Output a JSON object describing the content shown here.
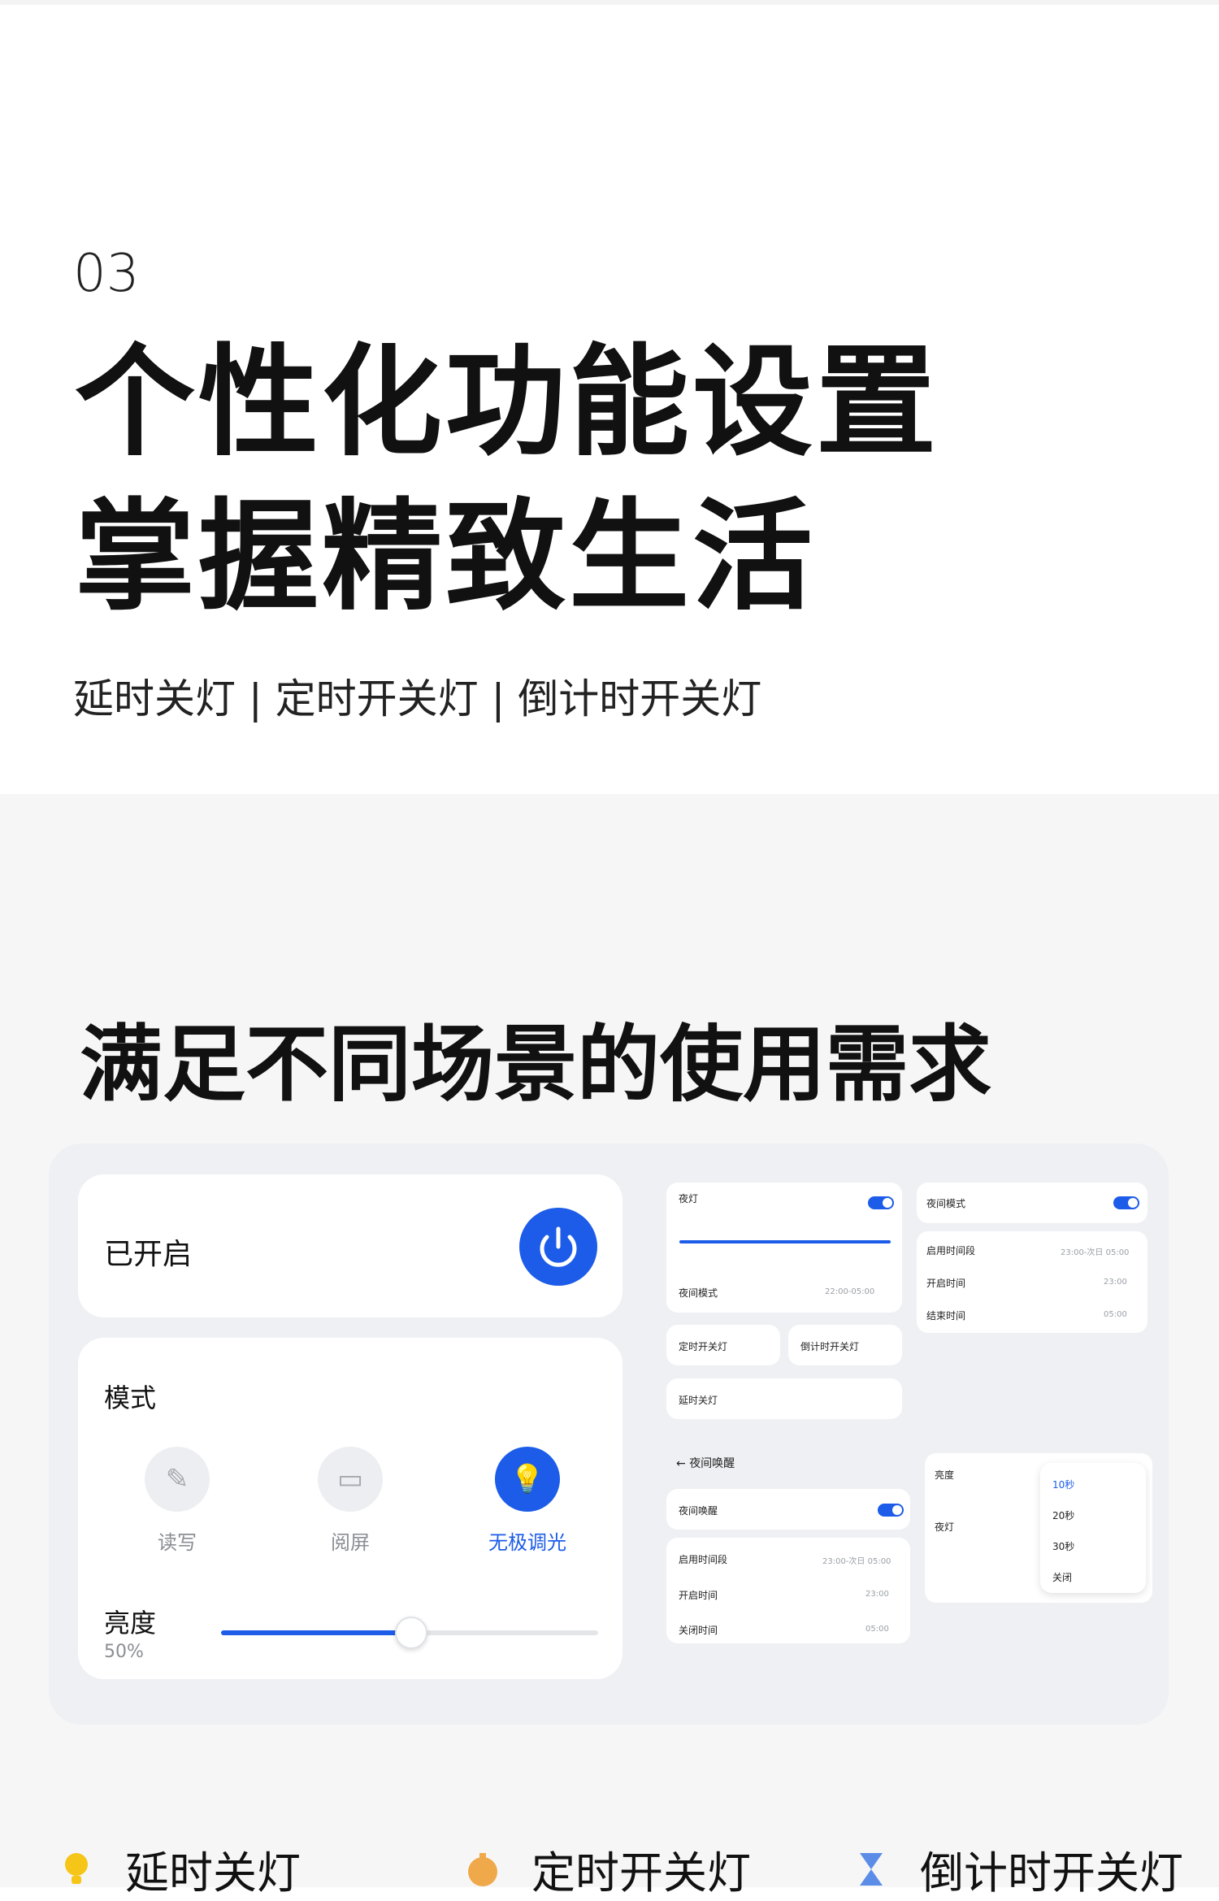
{
  "hero": {
    "number": "03",
    "title_line1": "个性化功能设置",
    "title_line2": "掌握精致生活",
    "subtitle": "延时关灯 | 定时开关灯 | 倒计时开关灯"
  },
  "section": {
    "title": "满足不同场景的使用需求"
  },
  "control": {
    "status_label": "已开启",
    "mode_label": "模式",
    "modes": [
      {
        "label": "读写",
        "icon": "read-write-icon",
        "active": false
      },
      {
        "label": "阅屏",
        "icon": "screen-icon",
        "active": false
      },
      {
        "label": "无极调光",
        "icon": "bulb-icon",
        "active": true
      }
    ],
    "brightness_label": "亮度",
    "brightness_value": "50%",
    "brightness_level": 0.5
  },
  "mini": {
    "night_light": "夜灯",
    "night_mode": "夜间模式",
    "night_mode_time": "22:00-05:00",
    "timer_onoff": "定时开关灯",
    "countdown_onoff": "倒计时开关灯",
    "delay_off": "延时关灯",
    "night_mode2": "夜间模式",
    "enable_period": "启用时间段",
    "enable_period_value": "23:00-次日 05:00",
    "on_time": "开启时间",
    "on_time_value": "23:00",
    "off_time": "结束时间",
    "off_time_value": "05:00",
    "back_title": "夜间唤醒",
    "night_wake": "夜间唤醒",
    "period2": "启用时间段",
    "period2_value": "23:00-次日 05:00",
    "on2": "开启时间",
    "on2_value": "23:00",
    "off2": "关闭时间",
    "off2_value": "05:00",
    "brightness": "亮度",
    "night_light2": "夜灯",
    "option1": "10秒",
    "option2": "20秒",
    "option3": "30秒",
    "option4": "关闭",
    "night_wake2": "夜间唤醒",
    "delay_off2": "延时关灯"
  },
  "features": [
    {
      "label": "延时关灯",
      "icon": "bulb-icon",
      "color": "#f5c518"
    },
    {
      "label": "定时开关灯",
      "icon": "timer-icon",
      "color": "#f0a94a"
    },
    {
      "label": "倒计时开关灯",
      "icon": "hourglass-icon",
      "color": "#5b8de8"
    }
  ],
  "colors": {
    "accent": "#1c5ce8",
    "background": "#f6f6f7"
  }
}
